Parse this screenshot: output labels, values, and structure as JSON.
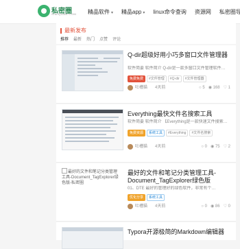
{
  "site": {
    "logo_text": "私密圈",
    "logo_sub": "SIMIQUAN.COM"
  },
  "nav": [
    {
      "label": "精品软件",
      "caret": true
    },
    {
      "label": "精品app",
      "caret": true
    },
    {
      "label": "linux命令查询",
      "caret": false
    },
    {
      "label": "资源网",
      "caret": false
    },
    {
      "label": "私密圈导航",
      "caret": false
    }
  ],
  "section": {
    "title": "最新发布",
    "tabs": [
      "推荐",
      "最新",
      "热门",
      "点赞",
      "评论"
    ]
  },
  "articles": [
    {
      "title": "Q-dir超级好用小巧多窗口文件管理器",
      "excerpt": "软件简要 软件简介 Q-dir是一款多窗口文件管理软件…",
      "tags": [
        "免费免费",
        "#文件管理",
        "#Q-dir",
        "#文件管理器"
      ],
      "author": "吐槽猫",
      "time": "4天前",
      "stats": [
        "5",
        "168",
        "1"
      ]
    },
    {
      "title": "Everything最快文件名搜索工具",
      "excerpt": "软件简要 软件简介 【Everything是一款快速文件搜索…",
      "tags": [
        "免费资源",
        "系统工具",
        "#Everything",
        "#文件名搜索"
      ],
      "author": "吐槽猫",
      "time": "4天前",
      "stats": [
        "0",
        "75",
        "2"
      ]
    },
    {
      "title": "最好的文件和笔记分类管理工具-Document_TagExplorer绿色版",
      "excerpt": "01、DTE 最好的管理好的绿色软件，非常有个…",
      "tags": [
        "优化分享",
        "系统工具"
      ],
      "author": "吐槽猫",
      "time": "4天前",
      "stats": [
        "0",
        "86",
        "0"
      ],
      "image_alt": "最好的文件和笔记分类管理工具-Document_TagExplorer绿色版-私密圈"
    },
    {
      "title": "Typora开源极简的Markdown编辑器",
      "excerpt": "",
      "tags": [],
      "author": "",
      "time": "",
      "stats": []
    }
  ]
}
